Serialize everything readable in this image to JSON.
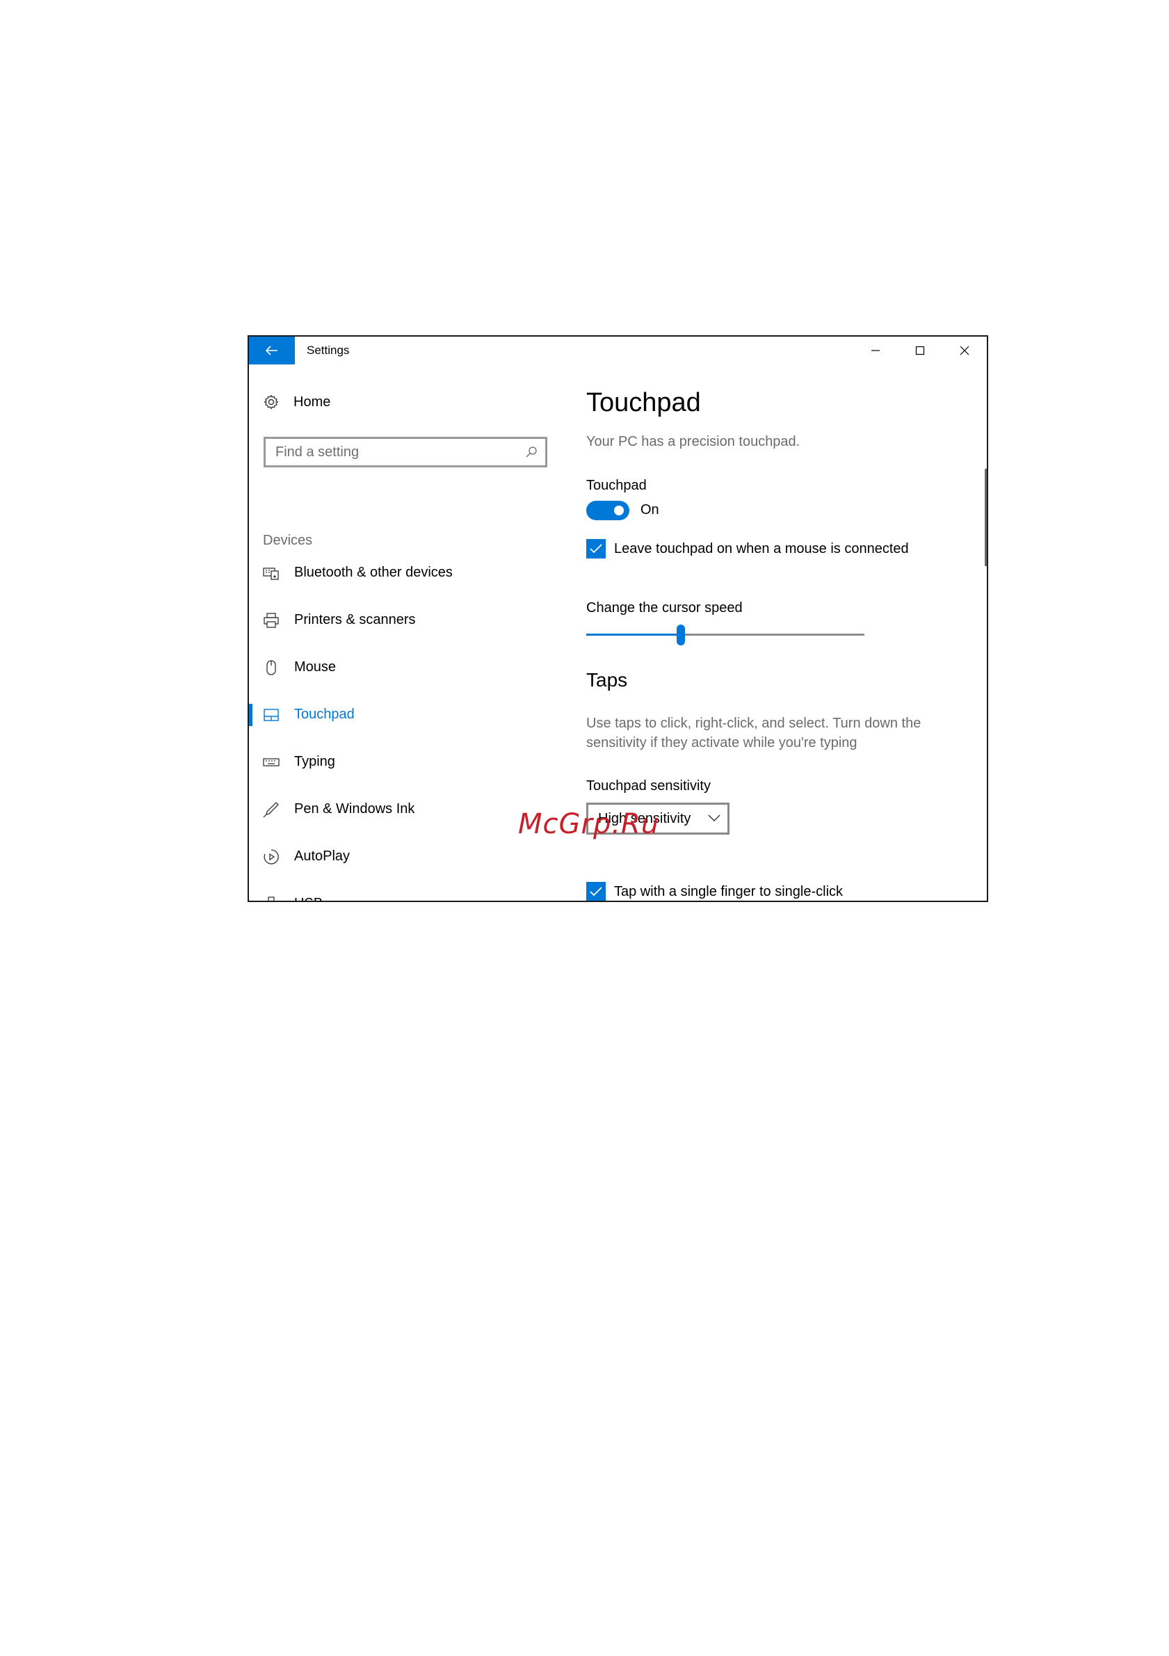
{
  "window": {
    "title": "Settings",
    "controls": {
      "minimize": "minimize-icon",
      "maximize": "maximize-icon",
      "close": "close-icon"
    }
  },
  "sidebar": {
    "home_label": "Home",
    "search_placeholder": "Find a setting",
    "section_heading": "Devices",
    "items": [
      {
        "label": "Bluetooth & other devices",
        "icon": "bluetooth-devices-icon"
      },
      {
        "label": "Printers & scanners",
        "icon": "printer-icon"
      },
      {
        "label": "Mouse",
        "icon": "mouse-icon"
      },
      {
        "label": "Touchpad",
        "icon": "touchpad-icon",
        "active": true
      },
      {
        "label": "Typing",
        "icon": "keyboard-icon"
      },
      {
        "label": "Pen & Windows Ink",
        "icon": "pen-icon"
      },
      {
        "label": "AutoPlay",
        "icon": "autoplay-icon"
      },
      {
        "label": "USB",
        "icon": "usb-icon"
      }
    ]
  },
  "content": {
    "title": "Touchpad",
    "subtitle": "Your PC has a precision touchpad.",
    "touchpad_label": "Touchpad",
    "toggle_state": "On",
    "toggle_on": true,
    "leave_on_label": "Leave touchpad on when a mouse is connected",
    "leave_on_checked": true,
    "cursor_speed_label": "Change the cursor speed",
    "cursor_speed_fraction": 0.34,
    "taps_title": "Taps",
    "taps_description": "Use taps to click, right-click, and select. Turn down the sensitivity if they activate while you're typing",
    "sensitivity_label": "Touchpad sensitivity",
    "sensitivity_value": "High sensitivity",
    "single_tap_label": "Tap with a single finger to single-click",
    "single_tap_checked": true
  },
  "colors": {
    "accent": "#0078d7",
    "watermark": "#c8202a"
  },
  "watermark": "McGrp.Ru"
}
